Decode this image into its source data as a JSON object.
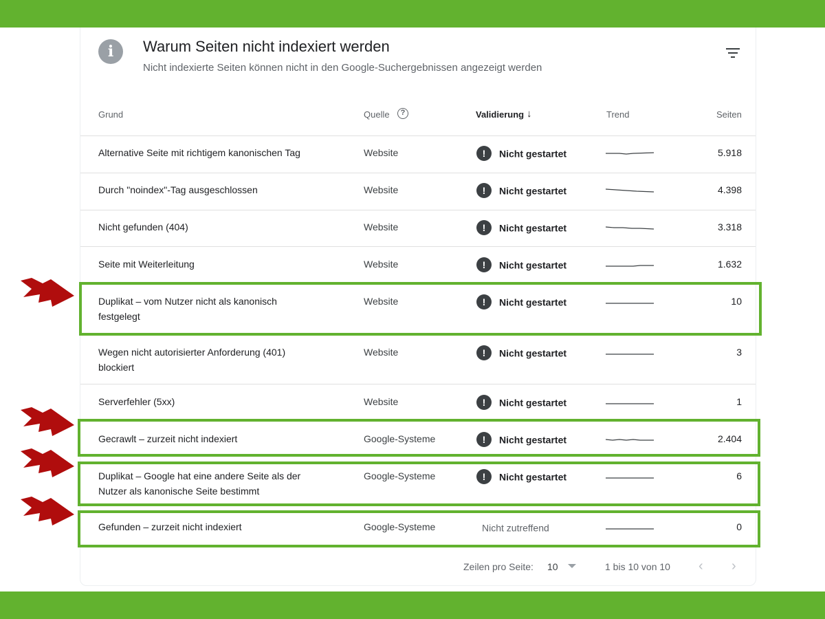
{
  "header": {
    "title": "Warum Seiten nicht indexiert werden",
    "subtitle": "Nicht indexierte Seiten können nicht in den Google-Suchergebnissen angezeigt werden"
  },
  "columns": {
    "grund": "Grund",
    "quelle": "Quelle",
    "validierung": "Validierung",
    "trend": "Trend",
    "seiten": "Seiten"
  },
  "rows": [
    {
      "grund": "Alternative Seite mit richtigem kanonischen Tag",
      "quelle": "Website",
      "validierung": "Nicht gestartet",
      "seiten": "5.918",
      "highlighted": false
    },
    {
      "grund": "Durch \"noindex\"-Tag ausgeschlossen",
      "quelle": "Website",
      "validierung": "Nicht gestartet",
      "seiten": "4.398",
      "highlighted": false
    },
    {
      "grund": "Nicht gefunden (404)",
      "quelle": "Website",
      "validierung": "Nicht gestartet",
      "seiten": "3.318",
      "highlighted": false
    },
    {
      "grund": "Seite mit Weiterleitung",
      "quelle": "Website",
      "validierung": "Nicht gestartet",
      "seiten": "1.632",
      "highlighted": false
    },
    {
      "grund": "Duplikat – vom Nutzer nicht als kanonisch festgelegt",
      "quelle": "Website",
      "validierung": "Nicht gestartet",
      "seiten": "10",
      "highlighted": true
    },
    {
      "grund": "Wegen nicht autorisierter Anforderung (401) blockiert",
      "quelle": "Website",
      "validierung": "Nicht gestartet",
      "seiten": "3",
      "highlighted": false
    },
    {
      "grund": "Serverfehler (5xx)",
      "quelle": "Website",
      "validierung": "Nicht gestartet",
      "seiten": "1",
      "highlighted": false
    },
    {
      "grund": "Gecrawlt – zurzeit nicht indexiert",
      "quelle": "Google-Systeme",
      "validierung": "Nicht gestartet",
      "seiten": "2.404",
      "highlighted": true
    },
    {
      "grund": "Duplikat – Google hat eine andere Seite als der Nutzer als kanonische Seite bestimmt",
      "quelle": "Google-Systeme",
      "validierung": "Nicht gestartet",
      "seiten": "6",
      "highlighted": true
    },
    {
      "grund": "Gefunden – zurzeit nicht indexiert",
      "quelle": "Google-Systeme",
      "validierung": "Nicht zutreffend",
      "seiten": "0",
      "highlighted": true
    }
  ],
  "footer": {
    "rows_per_page_label": "Zeilen pro Seite:",
    "rows_per_page_value": "10",
    "range_text": "1 bis 10 von 10"
  },
  "colors": {
    "accent_green": "#62b22f",
    "arrow_red": "#b00d0d",
    "status_icon": "#3c4043"
  },
  "icons": {
    "info": "info-icon",
    "filter": "filter-icon",
    "help": "help-circle-icon",
    "sort": "arrow-down-icon",
    "status": "exclamation-circle-icon",
    "prev": "chevron-left-icon",
    "next": "chevron-right-icon",
    "annotation": "red-arrow-icon"
  }
}
